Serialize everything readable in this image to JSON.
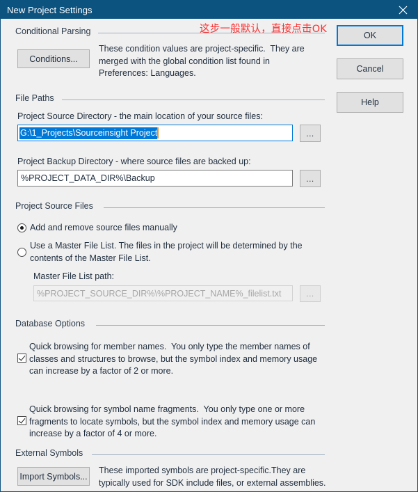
{
  "window": {
    "title": "New Project Settings",
    "close_icon": "close-icon"
  },
  "annotation": {
    "text": "这步一般默认，直接点击OK",
    "color": "#ff2f2f"
  },
  "buttons": {
    "ok": "OK",
    "cancel": "Cancel",
    "help": "Help",
    "conditions": "Conditions...",
    "import_symbols": "Import Symbols...",
    "browse_source": "...",
    "browse_backup": "...",
    "browse_filelist": "..."
  },
  "groups": {
    "conditional_parsing": {
      "label": "Conditional Parsing",
      "description": "These condition values are project-specific.  They are\nmerged with the global condition list found in\nPreferences: Languages."
    },
    "file_paths": {
      "label": "File Paths",
      "source_label": "Project Source Directory - the main location of your source files:",
      "source_value": "G:\\1_Projects\\Sourceinsight Project",
      "backup_label": "Project Backup Directory - where source files are backed up:",
      "backup_value": "%PROJECT_DATA_DIR%\\Backup"
    },
    "project_source_files": {
      "label": "Project Source Files",
      "radio_manual": "Add and remove source files manually",
      "radio_master": "Use a Master File List. The files in the project will be determined by the\ncontents of the Master File List.",
      "master_path_label": "Master File List path:",
      "master_path_value": "%PROJECT_SOURCE_DIR%\\%PROJECT_NAME%_filelist.txt"
    },
    "database_options": {
      "label": "Database Options",
      "option_member_names": "Quick browsing for member names.  You only type the member names of\nclasses and structures to browse, but the symbol index and memory usage\ncan increase by a factor of 2 or more.",
      "option_name_fragments": "Quick browsing for symbol name fragments.  You only type one or more\nfragments to locate symbols, but the symbol index and memory usage can\nincrease by a factor of 4 or more."
    },
    "external_symbols": {
      "label": "External Symbols",
      "description": "These imported symbols are project-specific.They are\ntypically used for SDK include files, or external assemblies."
    }
  },
  "state": {
    "source_files_mode": "manual",
    "quick_member_names_checked": true,
    "quick_name_fragments_checked": true,
    "master_path_enabled": false,
    "source_field_focused": true,
    "source_field_selected": true
  },
  "colors": {
    "titlebar": "#0d5380",
    "dialog_bg": "#f0f0f0",
    "accent": "#0078d7",
    "selection": "#0078d7",
    "annotation": "#ff2f2f"
  }
}
